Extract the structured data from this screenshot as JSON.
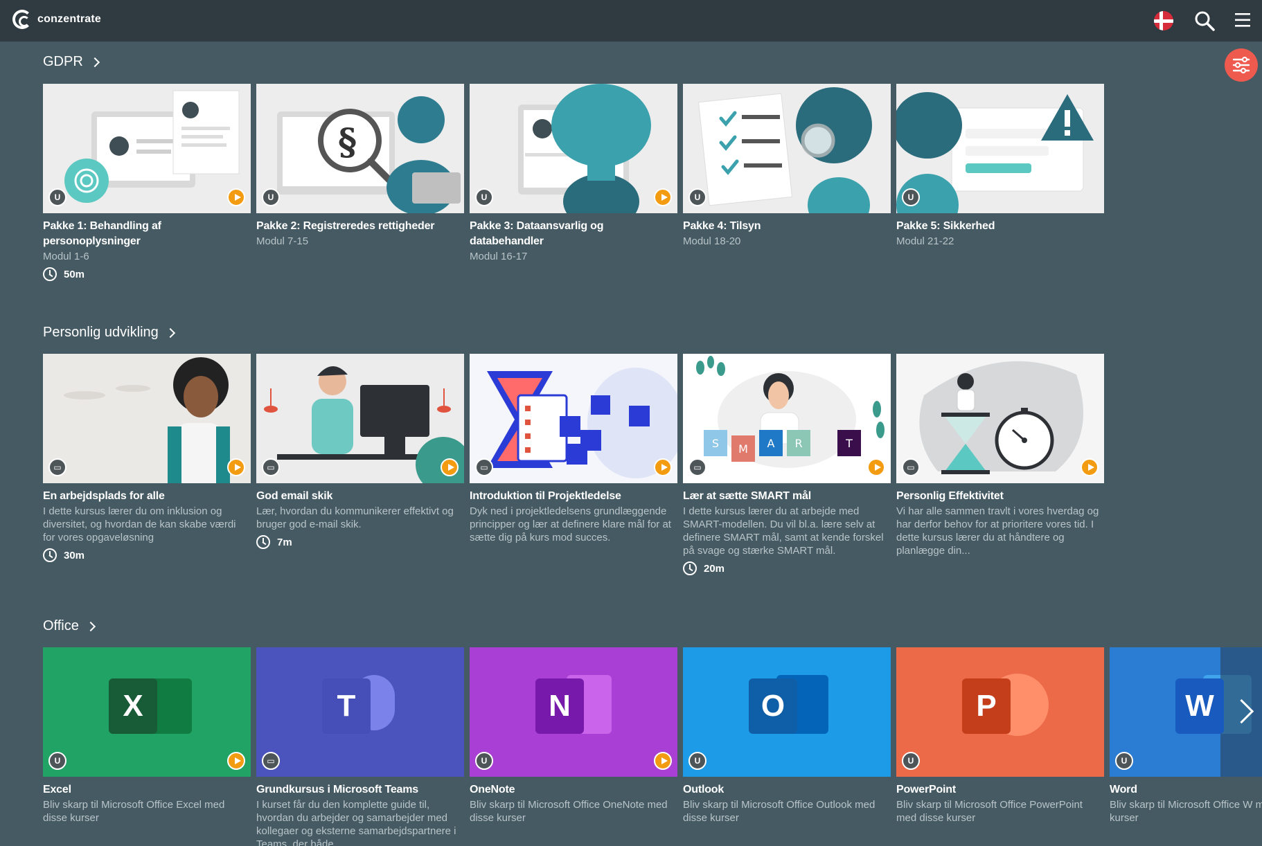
{
  "app": {
    "name": "conzentrate"
  },
  "sections": [
    {
      "title": "GDPR",
      "cards": [
        {
          "title": "Pakke 1: Behandling af personoplysninger",
          "sub": "Modul 1-6",
          "duration": "50m"
        },
        {
          "title": "Pakke 2: Registreredes rettigheder",
          "sub": "Modul 7-15"
        },
        {
          "title": "Pakke 3: Dataansvarlig og databehandler",
          "sub": "Modul 16-17"
        },
        {
          "title": "Pakke 4: Tilsyn",
          "sub": "Modul 18-20"
        },
        {
          "title": "Pakke 5: Sikkerhed",
          "sub": "Modul 21-22"
        }
      ]
    },
    {
      "title": "Personlig udvikling",
      "cards": [
        {
          "title": "En arbejdsplads for alle",
          "sub": "I dette kursus lærer du om inklusion og diversitet, og hvordan de kan skabe værdi for vores opgaveløsning",
          "duration": "30m"
        },
        {
          "title": "God email skik",
          "sub": "Lær, hvordan du kommunikerer effektivt og bruger god e-mail skik.",
          "duration": "7m"
        },
        {
          "title": "Introduktion til Projektledelse",
          "sub": "Dyk ned i projektledelsens grundlæggende principper og lær at definere klare mål for at sætte dig på kurs mod succes."
        },
        {
          "title": "Lær at sætte SMART mål",
          "sub": "I dette kursus lærer du at arbejde med SMART-modellen. Du vil bl.a. lære selv at definere SMART mål, samt at kende forskel på svage og stærke SMART mål.",
          "duration": "20m",
          "smart_letters": [
            "S",
            "M",
            "A",
            "R",
            "T"
          ]
        },
        {
          "title": "Personlig Effektivitet",
          "sub": "Vi har alle sammen travlt i vores hverdag og har derfor behov for at prioritere vores tid. I dette kursus lærer du at håndtere og planlægge din..."
        }
      ]
    },
    {
      "title": "Office",
      "cards": [
        {
          "title": "Excel",
          "sub": "Bliv skarp til Microsoft Office Excel med disse kurser",
          "letter": "X",
          "color": "#21a366"
        },
        {
          "title": "Grundkursus i Microsoft Teams",
          "sub": "I kurset får du den komplette guide til, hvordan du arbejder og samarbejder med kollegaer og eksterne samarbejdspartnere i Teams, der både",
          "letter": "T",
          "color": "#4b53bc"
        },
        {
          "title": "OneNote",
          "sub": "Bliv skarp til Microsoft Office OneNote med disse kurser",
          "letter": "N",
          "color": "#a93fd4"
        },
        {
          "title": "Outlook",
          "sub": "Bliv skarp til Microsoft Office Outlook med disse kurser",
          "letter": "O",
          "color": "#1e9be6"
        },
        {
          "title": "PowerPoint",
          "sub": "Bliv skarp til Microsoft Office PowerPoint med disse kurser",
          "letter": "P",
          "color": "#ed6a48"
        },
        {
          "title": "Word",
          "sub": "Bliv skarp til Microsoft Office W med disse kurser",
          "letter": "W",
          "color": "#2b7cd3"
        }
      ]
    }
  ],
  "colors": {
    "topbar": "#2f3b41",
    "background": "#455a63",
    "accent": "#ef5a4f",
    "play": "#f39c12"
  },
  "icons": {
    "flag": "danish-flag-icon",
    "search": "search-icon",
    "menu": "hamburger-menu-icon",
    "filter": "filter-sliders-icon",
    "next": "chevron-right-icon"
  }
}
